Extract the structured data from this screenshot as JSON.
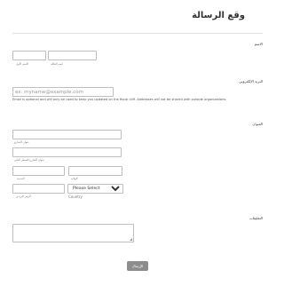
{
  "form": {
    "title": "وقع الرسالة",
    "name": {
      "label": "الاسم",
      "first_sublabel": "الاسم الأول",
      "last_sublabel": "اسم العائلة",
      "first_value": "",
      "last_value": ""
    },
    "email": {
      "label": "البريد الإلكتروني",
      "placeholder": "ex: myname@example.com",
      "value": "",
      "note": "Email is optional and will only be used to keep you updated on the fiscal cliff. Addresses will not be shared with outside organizations."
    },
    "address": {
      "label": "العنوان",
      "street_sublabel": "عنوان الشارع",
      "street2_sublabel": "عنوان الشارع السطر الثاني",
      "city_sublabel": "المدينة",
      "state_sublabel": "الولاية",
      "postal_sublabel": "الرمز البريدي",
      "country_selected": "Please Select",
      "country_sublabel": "Country"
    },
    "comments": {
      "label": "التعليقات",
      "value": ""
    },
    "submit_label": "الإرسال"
  }
}
